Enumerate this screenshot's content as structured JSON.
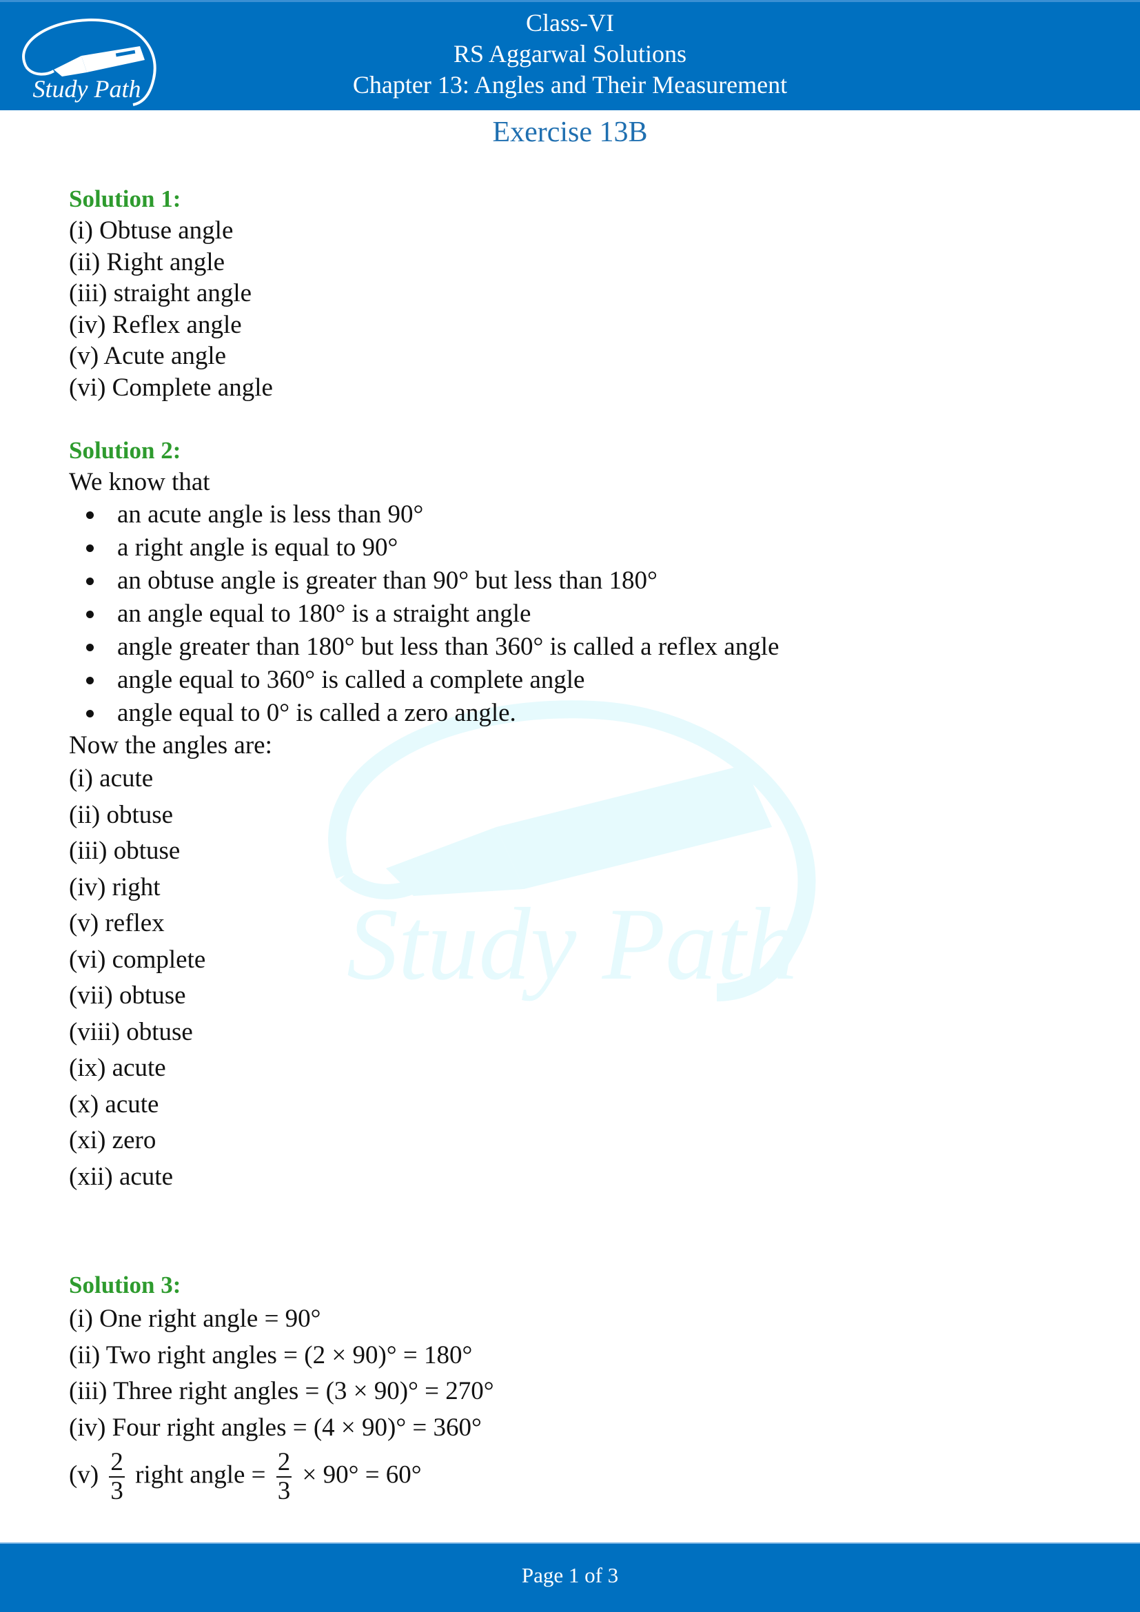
{
  "header": {
    "brand": "Study Path",
    "line1": "Class-VI",
    "line2": "RS Aggarwal Solutions",
    "line3": "Chapter 13: Angles and Their Measurement"
  },
  "exercise_title": "Exercise 13B",
  "colors": {
    "header_bg": "#0070C0",
    "title": "#1F6FB0",
    "solution_heading": "#2E9B2E",
    "watermark": "#E6FAFD"
  },
  "solutions": [
    {
      "heading": "Solution 1:",
      "lines": [
        "(i) Obtuse angle",
        "(ii) Right angle",
        "(iii) straight angle",
        "(iv) Reflex angle",
        "(v) Acute angle",
        "(vi) Complete angle"
      ]
    },
    {
      "heading": "Solution 2:",
      "intro": "We know that",
      "bullets": [
        "an acute angle is less than 90°",
        "a right angle is equal to 90°",
        "an obtuse angle is greater than 90° but less than 180°",
        "an angle equal to 180° is a straight angle",
        "angle greater than 180° but less than 360° is called a reflex angle",
        "angle equal to 360° is called a complete angle",
        "angle equal to 0° is called a zero angle."
      ],
      "followup": "Now the angles are:",
      "lines": [
        "(i) acute",
        "(ii) obtuse",
        "(iii) obtuse",
        "(iv) right",
        "(v) reflex",
        "(vi) complete",
        "(vii) obtuse",
        "(viii) obtuse",
        "(ix) acute",
        "(x) acute",
        "(xi) zero",
        "(xii) acute"
      ]
    },
    {
      "heading": "Solution 3:",
      "lines": [
        "(i) One right angle = 90°",
        "(ii) Two right angles = (2 × 90)° = 180°",
        "(iii) Three right angles = (3 × 90)° = 270°",
        "(iv) Four right angles = (4 × 90)° = 360°"
      ],
      "fraction_line": {
        "prefix": "(v)",
        "frac1_num": "2",
        "frac1_den": "3",
        "middle": "right angle =",
        "frac2_num": "2",
        "frac2_den": "3",
        "suffix": "× 90° = 60°"
      }
    }
  ],
  "footer": {
    "page_label": "Page 1 of 3"
  }
}
